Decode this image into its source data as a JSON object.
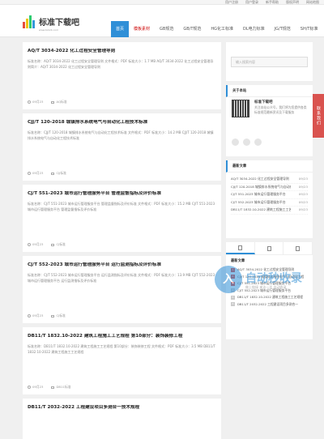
{
  "toplinks": [
    "用户注册",
    "用户登录",
    "新手帮助",
    "版权声明",
    "网站地图"
  ],
  "logo": {
    "name": "标准下载吧",
    "sub": "www.bzxzb.com"
  },
  "nav": [
    {
      "label": "首页",
      "state": "active"
    },
    {
      "label": "模板素材",
      "state": "hot"
    },
    {
      "label": "GB规范",
      "state": ""
    },
    {
      "label": "GB/T规范",
      "state": ""
    },
    {
      "label": "HG化工标准",
      "state": ""
    },
    {
      "label": "DL电力标准",
      "state": ""
    },
    {
      "label": "JG/T规范",
      "state": ""
    },
    {
      "label": "SH/T标准",
      "state": ""
    }
  ],
  "articles": [
    {
      "title": "AQ/T 3034-2022 化工过程安全管理导则",
      "desc": "标准名称：AQ/T 3034-2022 化工过程安全管理导则 文件格式：PDF 标准大小：1.7 MB AQ/T 3034-2022 化工过程安全管理导则简介：AQ/T 3034-2022 化工过程安全管理导则",
      "date": "09月23",
      "tag": "AQ标准"
    },
    {
      "title": "CJJ/T 120-2018 城镇排水系统电气与自动化工程技术标准",
      "desc": "标准名称：CJJ/T 120-2018 城镇排水系统电气与自动化工程技术标准 文件格式：PDF 标准大小：14.2 MB CJJ/T 120-2018 城镇排水系统电气与自动化工程技术标准",
      "date": "09月23",
      "tag": "CJJ标准"
    },
    {
      "title": "CJ/T 551-2023 城市运行管理服务平台 管理监督指标及评价标准",
      "desc": "标准名称：CJ/T 551-2023 城市运行管理服务平台 管理监督指标及评价标准 文件格式：PDF 标准大小：15.2 MB CJ/T 551-2023 城市运行管理服务平台 管理监督指标及评价标准",
      "date": "09月23",
      "tag": "CJ标准"
    },
    {
      "title": "CJ/T 552-2023 城市运行管理服务平台 运行监测指标及评价标准",
      "desc": "标准名称：CJ/T 552-2023 城市运行管理服务平台 运行监测指标及评价标准 文件格式：PDF 标准大小：13.9 MB CJ/T 552-2023 城市运行管理服务平台 运行监测指标及评价标准",
      "date": "09月23",
      "tag": "CJ标准"
    },
    {
      "title": "DB11/T 1832.10-2022 建筑工程施工工艺规程 第10部分：装饰装修工程",
      "desc": "标准名称：DB11/T 1832.10-2022 建筑工程施工工艺规程 第10部分：装饰装修工程 文件格式：PDF 标准大小：3.5 MB DB11/T 1832.10-2022 建筑工程施工工艺规程",
      "date": "09月23",
      "tag": "DB11标准"
    },
    {
      "title": "DB11/T 2032-2022 工程建设项目多测合一技术规程",
      "desc": "",
      "date": "",
      "tag": ""
    }
  ],
  "search": {
    "placeholder": "输入搜索内容"
  },
  "about": {
    "title": "关于本站",
    "name": "标准下载吧",
    "desc": "关注本站公众号，我们将为您提供各类标准规范最新资讯及下载服务"
  },
  "recent": {
    "title": "最新文章",
    "items": [
      {
        "t": "AQ/T 3034-2022 化工过程安全管理导则",
        "d": "09/23"
      },
      {
        "t": "CJJ/T 120-2018 城镇排水系统电气与自动化",
        "d": "09/23"
      },
      {
        "t": "CJ/T 551-2023 城市运行管理服务平台",
        "d": "09/23"
      },
      {
        "t": "CJ/T 552-2023 城市运行管理服务平台",
        "d": "09/23"
      },
      {
        "t": "DB11/T 1832.10-2022 建筑工程施工工艺规程",
        "d": "09/23"
      }
    ]
  },
  "tabs": {
    "title": "最新文章",
    "items": [
      {
        "n": "1",
        "t": "AQ/T 3034-2022 化工过程安全管理导则"
      },
      {
        "n": "2",
        "t": "CJJ/T 120-2018 城镇排水系统电气与自动化工程"
      },
      {
        "n": "3",
        "t": "CJ/T 551-2023 城市运行管理服务平台"
      },
      {
        "n": "4",
        "t": "CJ/T 552-2023 城市运行管理服务平台"
      },
      {
        "n": "5",
        "t": "DB11/T 1832.10-2022 建筑工程施工工艺规程"
      },
      {
        "n": "6",
        "t": "DB11/T 2032-2022 工程建设项目多测合一"
      }
    ]
  },
  "float_follow": "联系我们",
  "watermark": {
    "logo": "入",
    "title": "自动秒收录",
    "sub": "做上链接 来访一次 自动收录"
  },
  "colors": {
    "accent": "#2f8fd7",
    "hot": "#cc0000",
    "follow": "#d9534f"
  }
}
